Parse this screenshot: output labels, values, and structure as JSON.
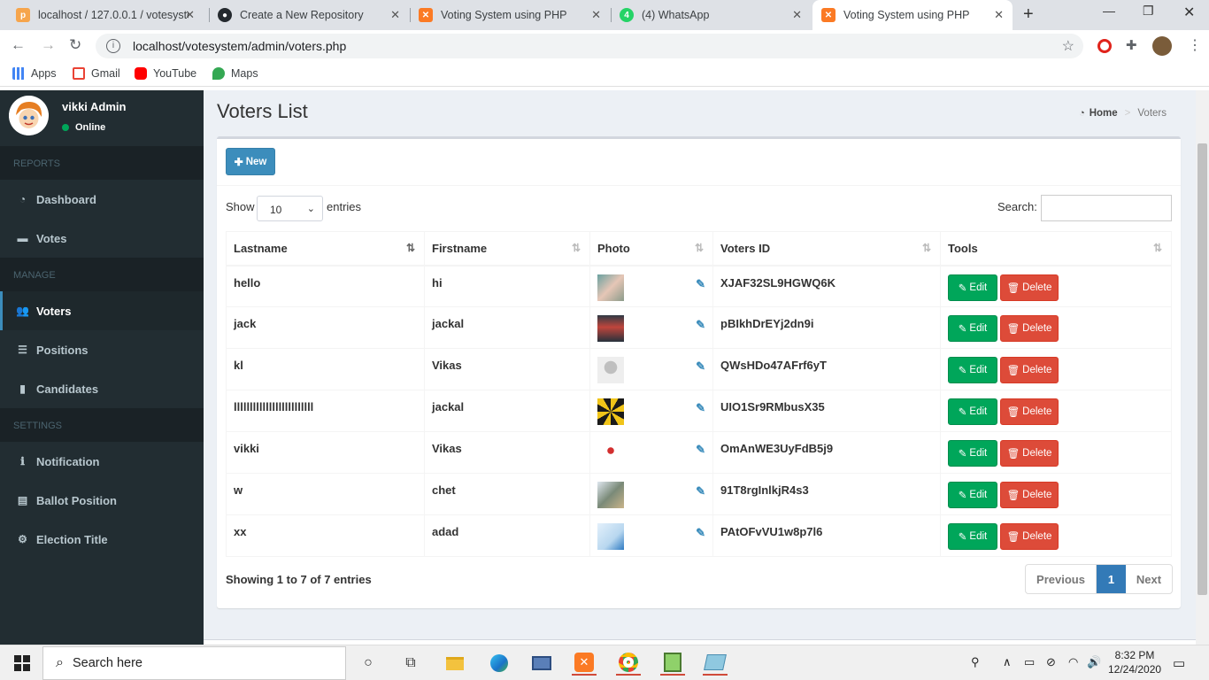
{
  "browser": {
    "tabs": [
      {
        "title": "localhost / 127.0.0.1 / votesyste",
        "icon": "phpmyadmin-icon"
      },
      {
        "title": "Create a New Repository",
        "icon": "github-icon"
      },
      {
        "title": "Voting System using PHP",
        "icon": "xampp-icon"
      },
      {
        "title": "(4) WhatsApp",
        "icon": "whatsapp-icon"
      },
      {
        "title": "Voting System using PHP",
        "icon": "xampp-icon",
        "active": true
      }
    ],
    "url": "localhost/votesystem/admin/voters.php",
    "bookmarks": [
      "Apps",
      "Gmail",
      "YouTube",
      "Maps"
    ]
  },
  "sidebar": {
    "user_name": "vikki Admin",
    "user_status": "Online",
    "sections": [
      {
        "header": "REPORTS",
        "items": [
          "Dashboard",
          "Votes"
        ]
      },
      {
        "header": "MANAGE",
        "items": [
          "Voters",
          "Positions",
          "Candidates"
        ]
      },
      {
        "header": "SETTINGS",
        "items": [
          "Notification",
          "Ballot Position",
          "Election Title"
        ]
      }
    ],
    "active_item": "Voters"
  },
  "page": {
    "title": "Voters List",
    "breadcrumb_home": "Home",
    "breadcrumb_current": "Voters"
  },
  "box": {
    "new_button": "New",
    "show_label": "Show",
    "page_length": "10",
    "entries_label": "entries",
    "search_label": "Search:",
    "search_value": ""
  },
  "table": {
    "columns": [
      "Lastname",
      "Firstname",
      "Photo",
      "Voters ID",
      "Tools"
    ],
    "rows": [
      {
        "lastname": "hello",
        "firstname": "hi",
        "voters_id": "XJAF32SL9HGWQ6K"
      },
      {
        "lastname": "jack",
        "firstname": "jackal",
        "voters_id": "pBIkhDrEYj2dn9i"
      },
      {
        "lastname": "kl",
        "firstname": "Vikas",
        "voters_id": "QWsHDo47AFrf6yT"
      },
      {
        "lastname": "lllllllllllllllllllllllll",
        "firstname": "jackal",
        "voters_id": "UIO1Sr9RMbusX35"
      },
      {
        "lastname": "vikki",
        "firstname": "Vikas",
        "voters_id": "OmAnWE3UyFdB5j9"
      },
      {
        "lastname": "w",
        "firstname": "chet",
        "voters_id": "91T8rgInlkjR4s3"
      },
      {
        "lastname": "xx",
        "firstname": "adad",
        "voters_id": "PAtOFvVU1w8p7l6"
      }
    ],
    "edit_label": "Edit",
    "delete_label": "Delete"
  },
  "footer": {
    "info": "Showing 1 to 7 of 7 entries",
    "previous": "Previous",
    "current_page": "1",
    "next": "Next"
  },
  "taskbar": {
    "search_placeholder": "Search here",
    "time": "8:32 PM",
    "date": "12/24/2020"
  },
  "colors": {
    "sidebar_bg": "#222d32",
    "primary": "#3c8dbc",
    "success": "#00a65a",
    "danger": "#dd4b39"
  }
}
